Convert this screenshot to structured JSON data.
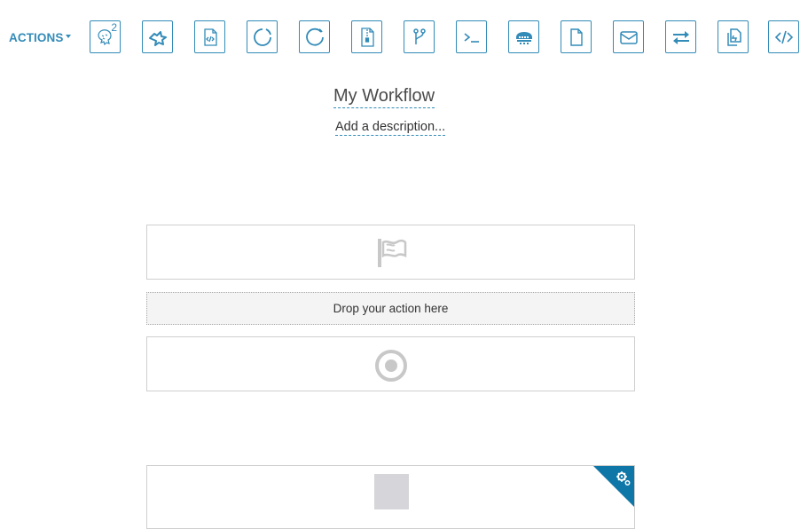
{
  "toolbar": {
    "actions_label": "ACTIONS",
    "hive_badge": "2",
    "tools": [
      {
        "icon": "hive-icon"
      },
      {
        "icon": "pig-icon"
      },
      {
        "icon": "java-icon"
      },
      {
        "icon": "sqoop-icon"
      },
      {
        "icon": "spark-icon"
      },
      {
        "icon": "zip-file-icon"
      },
      {
        "icon": "fork-icon"
      },
      {
        "icon": "shell-icon"
      },
      {
        "icon": "ssh-icon"
      },
      {
        "icon": "file-icon"
      },
      {
        "icon": "email-icon"
      },
      {
        "icon": "distcp-icon"
      },
      {
        "icon": "copy-icon"
      },
      {
        "icon": "code-icon"
      }
    ]
  },
  "workflow": {
    "title": "My Workflow",
    "description": "Add a description..."
  },
  "canvas": {
    "start_icon": "flag-icon",
    "drop_label": "Drop your action here",
    "end_icon": "target-icon",
    "settings_icon": "gears-icon"
  },
  "colors": {
    "accent": "#338bb8",
    "corner": "#0e77a8",
    "icon_gray": "#c8c8c8",
    "border": "#cfcfcf"
  }
}
